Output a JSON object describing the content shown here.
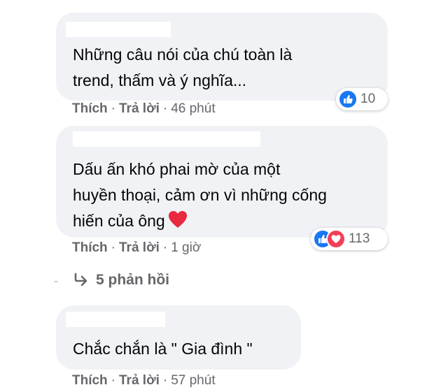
{
  "comments": [
    {
      "lines": [
        "Những câu nói của chú toàn là",
        "trend, thấm và ý nghĩa..."
      ],
      "like_label": "Thích",
      "reply_label": "Trả lời",
      "time": "46 phút",
      "reaction_icons": [
        "like-icon"
      ],
      "reaction_count": "10"
    },
    {
      "lines": [
        "Dấu ấn khó phai mờ của một",
        "huyền thoại, cảm ơn vì những cống",
        "hiến của ông"
      ],
      "like_label": "Thích",
      "reply_label": "Trả lời",
      "time": "1 giờ",
      "reaction_icons": [
        "like-icon",
        "love-icon"
      ],
      "reaction_count": "113",
      "replies_label": "5 phản hồi",
      "replies_icon": "reply-arrow-icon"
    },
    {
      "lines": [
        "Chắc chắn là \" Gia đình \""
      ],
      "like_label": "Thích",
      "reply_label": "Trả lời",
      "time": "57 phút"
    }
  ],
  "colors": {
    "bubble": "#f0f2f5",
    "text": "#050505",
    "meta": "#65676b",
    "like": "#1877f2",
    "love": "#f33e58",
    "heart_emoji": "#e8293e"
  }
}
